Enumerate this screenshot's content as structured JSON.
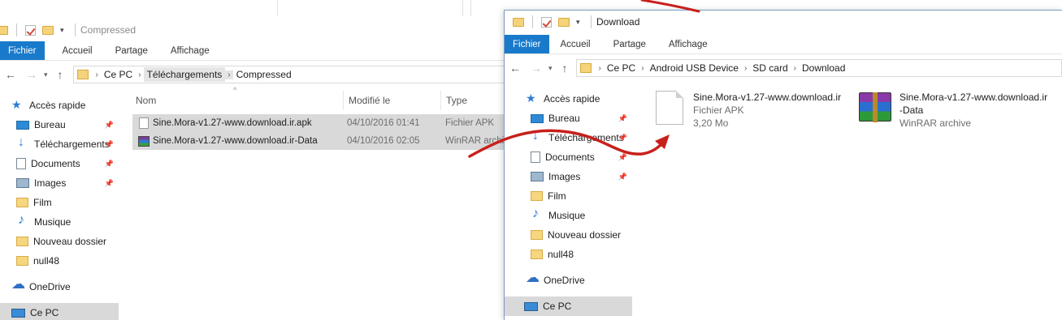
{
  "back_window": {
    "title": "Compressed",
    "tabs": [
      "Fichier",
      "Accueil",
      "Partage",
      "Affichage"
    ],
    "breadcrumb": [
      "Ce PC",
      "Téléchargements",
      "Compressed"
    ],
    "nav_items": [
      {
        "label": "Accès rapide",
        "icon": "star-icon"
      },
      {
        "label": "Bureau",
        "icon": "desktop-icon",
        "pinned": true
      },
      {
        "label": "Téléchargements",
        "icon": "download-icon",
        "pinned": true
      },
      {
        "label": "Documents",
        "icon": "documents-icon",
        "pinned": true
      },
      {
        "label": "Images",
        "icon": "images-icon",
        "pinned": true
      },
      {
        "label": "Film",
        "icon": "folder-icon"
      },
      {
        "label": "Musique",
        "icon": "music-icon"
      },
      {
        "label": "Nouveau dossier",
        "icon": "folder-icon"
      },
      {
        "label": "null48",
        "icon": "folder-icon"
      },
      {
        "label": "OneDrive",
        "icon": "cloud-icon"
      },
      {
        "label": "Ce PC",
        "icon": "pc-icon"
      }
    ],
    "columns": {
      "name": "Nom",
      "modified": "Modifié le",
      "type": "Type"
    },
    "files": [
      {
        "name": "Sine.Mora-v1.27-www.download.ir.apk",
        "modified": "04/10/2016 01:41",
        "type": "Fichier APK",
        "icon": "file-icon"
      },
      {
        "name": "Sine.Mora-v1.27-www.download.ir-Data",
        "modified": "04/10/2016 02:05",
        "type": "WinRAR archi",
        "icon": "rar-icon"
      }
    ]
  },
  "front_window": {
    "title": "Download",
    "tabs": [
      "Fichier",
      "Accueil",
      "Partage",
      "Affichage"
    ],
    "breadcrumb": [
      "Ce PC",
      "Android USB Device",
      "SD card",
      "Download"
    ],
    "nav_items": [
      {
        "label": "Accès rapide",
        "icon": "star-icon"
      },
      {
        "label": "Bureau",
        "icon": "desktop-icon",
        "pinned": true
      },
      {
        "label": "Téléchargements",
        "icon": "download-icon",
        "pinned": true
      },
      {
        "label": "Documents",
        "icon": "documents-icon",
        "pinned": true
      },
      {
        "label": "Images",
        "icon": "images-icon",
        "pinned": true
      },
      {
        "label": "Film",
        "icon": "folder-icon"
      },
      {
        "label": "Musique",
        "icon": "music-icon"
      },
      {
        "label": "Nouveau dossier",
        "icon": "folder-icon"
      },
      {
        "label": "null48",
        "icon": "folder-icon"
      },
      {
        "label": "OneDrive",
        "icon": "cloud-icon"
      },
      {
        "label": "Ce PC",
        "icon": "pc-icon"
      }
    ],
    "items": [
      {
        "name": "Sine.Mora-v1.27-www.download.ir",
        "line2": "Fichier APK",
        "line3": "3,20 Mo",
        "icon": "apk-file-icon"
      },
      {
        "name1": "Sine.Mora-v1.27-www.download.ir",
        "name2": "-Data",
        "line2": "WinRAR archive",
        "icon": "winrar-archive-icon"
      }
    ]
  },
  "colors": {
    "ribbon_file_tab": "#1979ca",
    "selection": "#d9d9d9",
    "annotation_arrow": "#c8201c"
  }
}
